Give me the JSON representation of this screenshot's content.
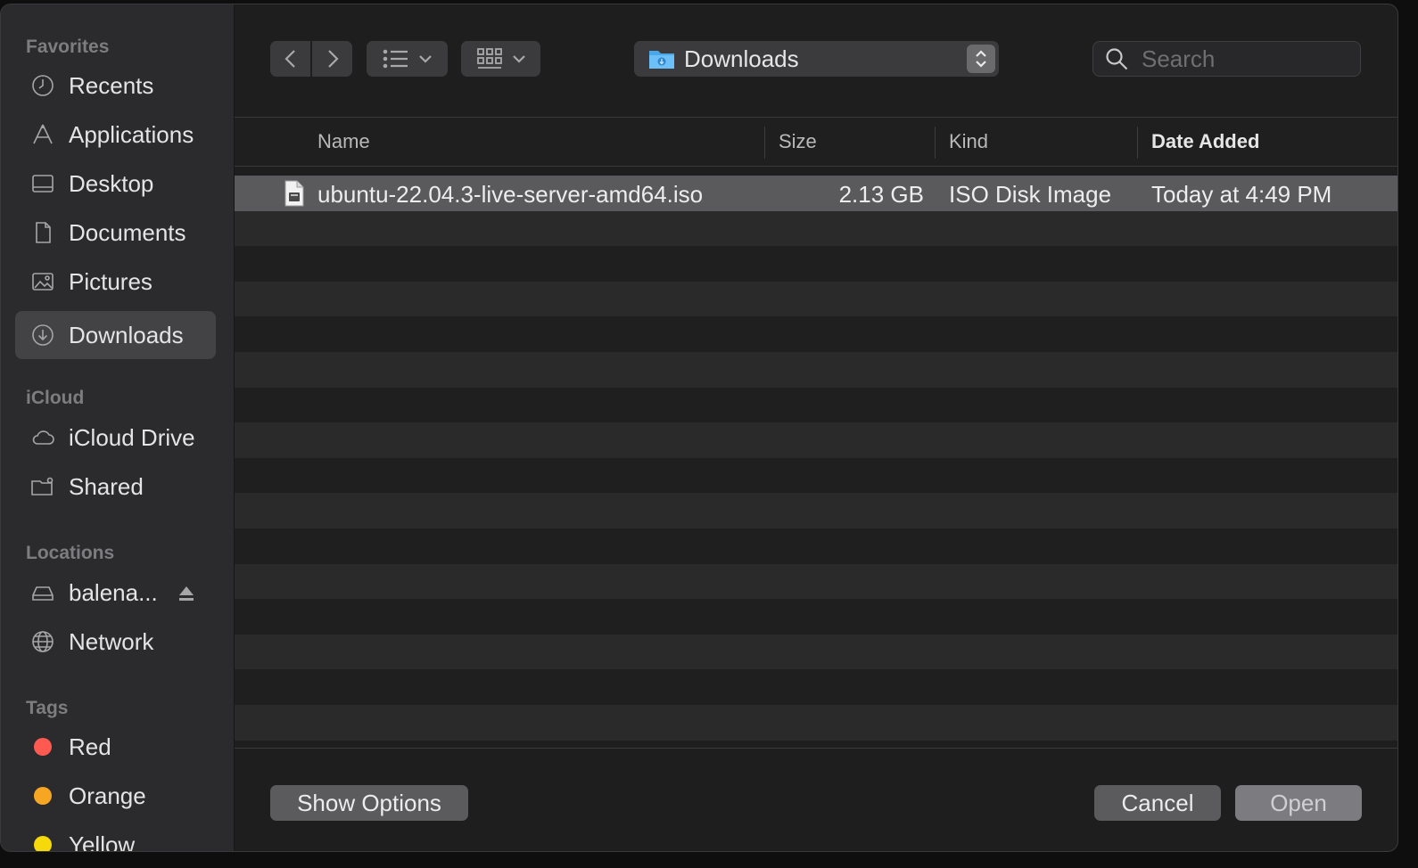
{
  "sidebar": {
    "sections": {
      "favorites": "Favorites",
      "icloud": "iCloud",
      "locations": "Locations",
      "tags": "Tags"
    },
    "favorites": [
      {
        "label": "Recents",
        "icon": "clock-icon"
      },
      {
        "label": "Applications",
        "icon": "applications-icon"
      },
      {
        "label": "Desktop",
        "icon": "desktop-icon"
      },
      {
        "label": "Documents",
        "icon": "document-icon"
      },
      {
        "label": "Pictures",
        "icon": "pictures-icon"
      },
      {
        "label": "Downloads",
        "icon": "downloads-icon",
        "selected": true
      }
    ],
    "icloud": [
      {
        "label": "iCloud Drive",
        "icon": "cloud-icon"
      },
      {
        "label": "Shared",
        "icon": "shared-folder-icon"
      }
    ],
    "locations": [
      {
        "label": "balena...",
        "icon": "drive-icon"
      },
      {
        "label": "Network",
        "icon": "globe-icon"
      }
    ],
    "tags": [
      {
        "label": "Red",
        "color": "#ff5a52"
      },
      {
        "label": "Orange",
        "color": "#f5a623"
      },
      {
        "label": "Yellow",
        "color": "#f5d90a"
      }
    ]
  },
  "toolbar": {
    "location": "Downloads",
    "search_placeholder": "Search"
  },
  "columns": {
    "name": "Name",
    "size": "Size",
    "kind": "Kind",
    "date_added": "Date Added"
  },
  "files": [
    {
      "name": "ubuntu-22.04.3-live-server-amd64.iso",
      "size": "2.13 GB",
      "kind": "ISO Disk Image",
      "date_added": "Today at 4:49 PM"
    }
  ],
  "buttons": {
    "show_options": "Show Options",
    "cancel": "Cancel",
    "open": "Open"
  }
}
